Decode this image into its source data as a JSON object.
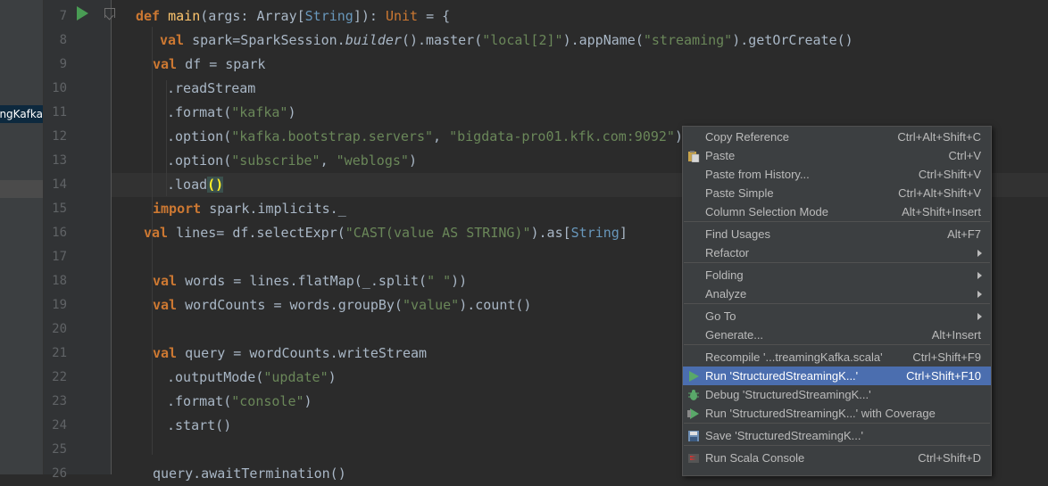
{
  "project_panel": {
    "selected_item": "StructuredStreamingKafka"
  },
  "gutter": {
    "line_numbers": [
      "7",
      "8",
      "9",
      "10",
      "11",
      "12",
      "13",
      "14",
      "15",
      "16",
      "17",
      "18",
      "19",
      "20",
      "21",
      "22",
      "23",
      "24",
      "25",
      "26"
    ]
  },
  "code": {
    "l7": {
      "kw": "def ",
      "name": "main",
      "a": "(args: Array[",
      "ty": "String",
      "b": "]): ",
      "unit": "Unit",
      " c": " = {"
    },
    "l8": {
      "kw": "val ",
      "a": "spark=SparkSession.",
      "it": "builder",
      "b": "().master(",
      "s1": "\"local[2]\"",
      "c": ").appName(",
      "s2": "\"streaming\"",
      "d": ").getOrCreate()"
    },
    "l9": {
      "kw": "val ",
      "a": "df = spark"
    },
    "l10": {
      "a": ".readStream"
    },
    "l11": {
      "a": ".format(",
      "s": "\"kafka\"",
      "b": ")"
    },
    "l12": {
      "a": ".option(",
      "s1": "\"kafka.bootstrap.servers\"",
      "b": ", ",
      "s2": "\"bigdata-pro01.kfk.com:9092\"",
      "c": ")"
    },
    "l13": {
      "a": ".option(",
      "s1": "\"subscribe\"",
      "b": ", ",
      "s2": "\"weblogs\"",
      "c": ")"
    },
    "l14": {
      "a": ".load",
      "b": "()"
    },
    "l15": {
      "kw": "import ",
      "a": "spark.implicits._"
    },
    "l16": {
      "kw": "val ",
      "a": "lines= df.selectExpr(",
      "s": "\"CAST(value AS STRING)\"",
      "b": ").as[",
      "ty": "String",
      "c": "]"
    },
    "l18": {
      "kw": "val ",
      "a": "words = lines.flatMap(_.split(",
      "s": "\" \"",
      "b": "))"
    },
    "l19": {
      "kw": "val ",
      "a": "wordCounts = words.groupBy(",
      "s": "\"value\"",
      "b": ").count()"
    },
    "l21": {
      "kw": "val ",
      "a": "query = wordCounts.writeStream"
    },
    "l22": {
      "a": ".outputMode(",
      "s": "\"update\"",
      "b": ")"
    },
    "l23": {
      "a": ".format(",
      "s": "\"console\"",
      "b": ")"
    },
    "l24": {
      "a": ".start()"
    },
    "l26": {
      "a": "query.awaitTermination()"
    }
  },
  "context_menu": {
    "items": [
      {
        "label": "Copy Reference",
        "shortcut": "Ctrl+Alt+Shift+C"
      },
      {
        "label": "Paste",
        "shortcut": "Ctrl+V",
        "icon": "paste-icon"
      },
      {
        "label": "Paste from History...",
        "shortcut": "Ctrl+Shift+V"
      },
      {
        "label": "Paste Simple",
        "shortcut": "Ctrl+Alt+Shift+V"
      },
      {
        "label": "Column Selection Mode",
        "shortcut": "Alt+Shift+Insert"
      },
      {
        "label": "Find Usages",
        "shortcut": "Alt+F7"
      },
      {
        "label": "Refactor",
        "submenu": true
      },
      {
        "label": "Folding",
        "submenu": true
      },
      {
        "label": "Analyze",
        "submenu": true
      },
      {
        "label": "Go To",
        "submenu": true
      },
      {
        "label": "Generate...",
        "shortcut": "Alt+Insert"
      },
      {
        "label": "Recompile '...treamingKafka.scala'",
        "shortcut": "Ctrl+Shift+F9"
      },
      {
        "label": "Run 'StructuredStreamingK...'",
        "shortcut": "Ctrl+Shift+F10",
        "icon": "run-icon",
        "active": true
      },
      {
        "label": "Debug 'StructuredStreamingK...'",
        "icon": "debug-icon"
      },
      {
        "label": "Run 'StructuredStreamingK...' with Coverage",
        "icon": "coverage-icon"
      },
      {
        "label": "Save 'StructuredStreamingK...'",
        "icon": "save-icon"
      },
      {
        "label": "Run Scala Console",
        "shortcut": "Ctrl+Shift+D",
        "icon": "scala-console-icon"
      }
    ]
  },
  "colors": {
    "editor_bg": "#2b2b2b",
    "keyword": "#cc7832",
    "string": "#6a8759",
    "menu_bg": "#3c3f41",
    "menu_active": "#4b6eaf",
    "run_green": "#499c54"
  }
}
